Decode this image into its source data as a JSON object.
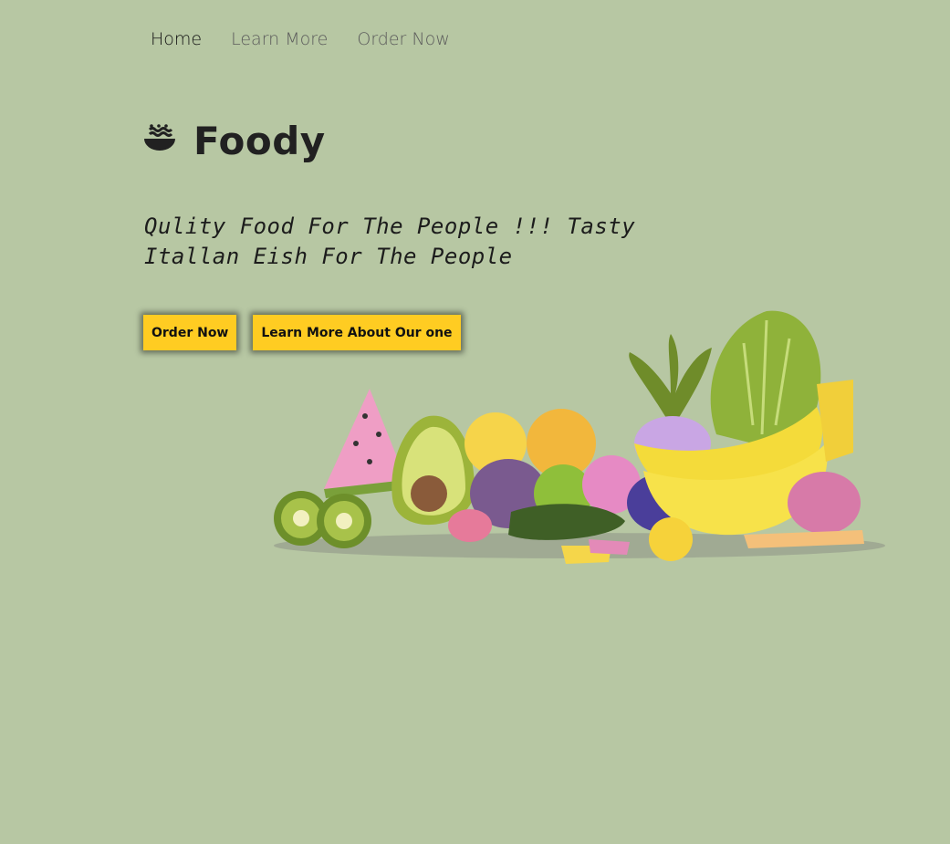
{
  "nav": {
    "home": "Home",
    "learn_more": "Learn More",
    "order_now": "Order Now"
  },
  "brand": {
    "title": "Foody",
    "icon": "food-bowl-icon"
  },
  "tagline": "Qulity Food For The People !!! Tasty Itallan Eish For The People",
  "buttons": {
    "order_now": "Order Now",
    "learn_more": "Learn More About Our one"
  },
  "hero": {
    "image": "fruits-and-vegetables-illustration"
  },
  "colors": {
    "background": "#b7c7a3",
    "button": "#ffcc22",
    "text": "#212121"
  }
}
